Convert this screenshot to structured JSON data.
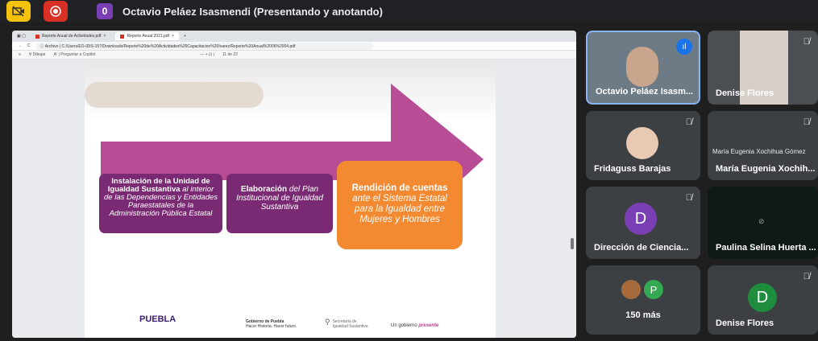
{
  "topbar": {
    "badge": "0",
    "title": "Octavio Peláez Isasmendi (Presentando y anotando)"
  },
  "browser": {
    "tab1": "Reporte Anual de Actividades.pdf",
    "tab2": "Reporte Anual 2021.pdf",
    "url_prefix": "Archivo",
    "url": "C:/Users/EO-IDIS-157/Downloads/Reporte%20de%20Actividades%20Capacitacion%20Ivarez/Reporte%20Anual%2006%2004.pdf",
    "draw_label": "Dibujar",
    "read_label": "Preguntar a Copilot",
    "page_info": "de 22"
  },
  "slide": {
    "box1_bold": "Instalación de la Unidad de Igualdad Sustantiva",
    "box1_italic": " al interior de las Dependencias y Entidades Paraestatales de la Administración Pública Estatal",
    "box2_bold": "Elaboración",
    "box2_italic": " del Plan Institucional de Igualdad Sustantiva",
    "box3_bold": "Rendición de cuentas",
    "box3_italic": "ante el Sistema Estatal para la Igualdad entre Mujeres y Hombres",
    "logo1": "PUEBLA",
    "logo2_line1": "Gobierno de Puebla",
    "logo2_line2": "Hacer Historia. Hacer futuro.",
    "logo3_line1": "Secretaría de",
    "logo3_line2": "Igualdad Sustantiva",
    "logo4_a": "Un gobierno ",
    "logo4_b": "presente"
  },
  "participants": {
    "p1": "Octavio Peláez Isasm...",
    "p2": "Denise Flores",
    "p3": "Fridaguss Barajas",
    "p4_label": "María Eugenia Xochihua Gómez",
    "p4": "María Eugenia Xochih...",
    "p5_initial": "D",
    "p5": "Dirección de Ciencia...",
    "p6": "Paulina Selina Huerta ...",
    "p7_initial": "P",
    "p7": "150 más",
    "p8_initial": "D",
    "p8": "Denise Flores"
  },
  "colors": {
    "accent_purple": "#7a2a73",
    "arrow_magenta": "#b3438f",
    "orange": "#f38a32",
    "avatar_purple": "#7b3fb5",
    "avatar_green": "#1e8e3e"
  }
}
